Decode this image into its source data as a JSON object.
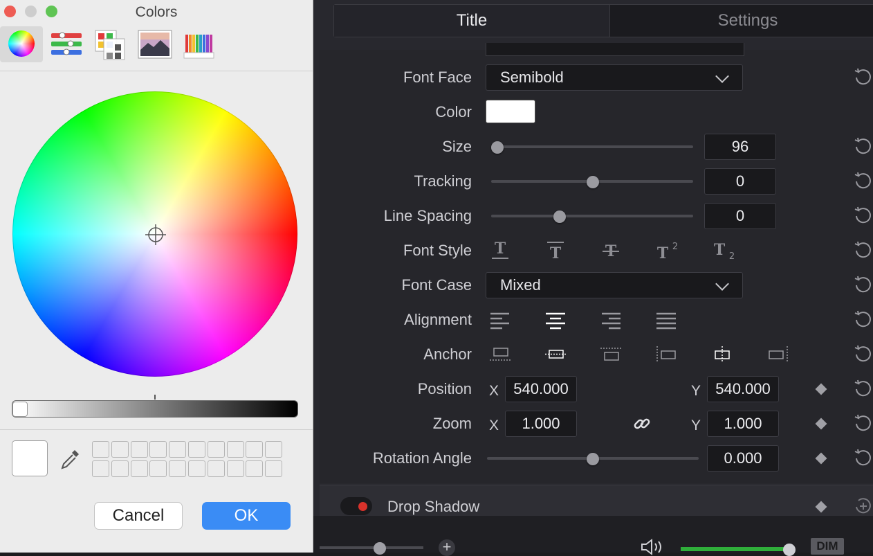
{
  "colors_panel": {
    "title": "Colors",
    "modes": [
      "color-wheel",
      "sliders",
      "palettes",
      "image-palettes",
      "pencils"
    ],
    "buttons": {
      "cancel": "Cancel",
      "ok": "OK"
    }
  },
  "inspector": {
    "tabs": [
      {
        "label": "Title",
        "active": true
      },
      {
        "label": "Settings",
        "active": false
      }
    ],
    "font_face": {
      "label": "Font Face",
      "value": "Semibold"
    },
    "color": {
      "label": "Color",
      "value": "#ffffff"
    },
    "size": {
      "label": "Size",
      "value": "96",
      "slider": 0.03
    },
    "tracking": {
      "label": "Tracking",
      "value": "0",
      "slider": 0.5
    },
    "line_spacing": {
      "label": "Line Spacing",
      "value": "0",
      "slider": 0.34
    },
    "font_style": {
      "label": "Font Style"
    },
    "font_case": {
      "label": "Font Case",
      "value": "Mixed"
    },
    "alignment": {
      "label": "Alignment"
    },
    "anchor": {
      "label": "Anchor"
    },
    "position": {
      "label": "Position",
      "x_label": "X",
      "x": "540.000",
      "y_label": "Y",
      "y": "540.000"
    },
    "zoom": {
      "label": "Zoom",
      "x_label": "X",
      "x": "1.000",
      "y_label": "Y",
      "y": "1.000"
    },
    "rotation": {
      "label": "Rotation Angle",
      "value": "0.000",
      "slider": 0.5
    },
    "drop_shadow": {
      "label": "Drop Shadow"
    }
  },
  "bottom_bar": {
    "dim_label": "DIM"
  }
}
